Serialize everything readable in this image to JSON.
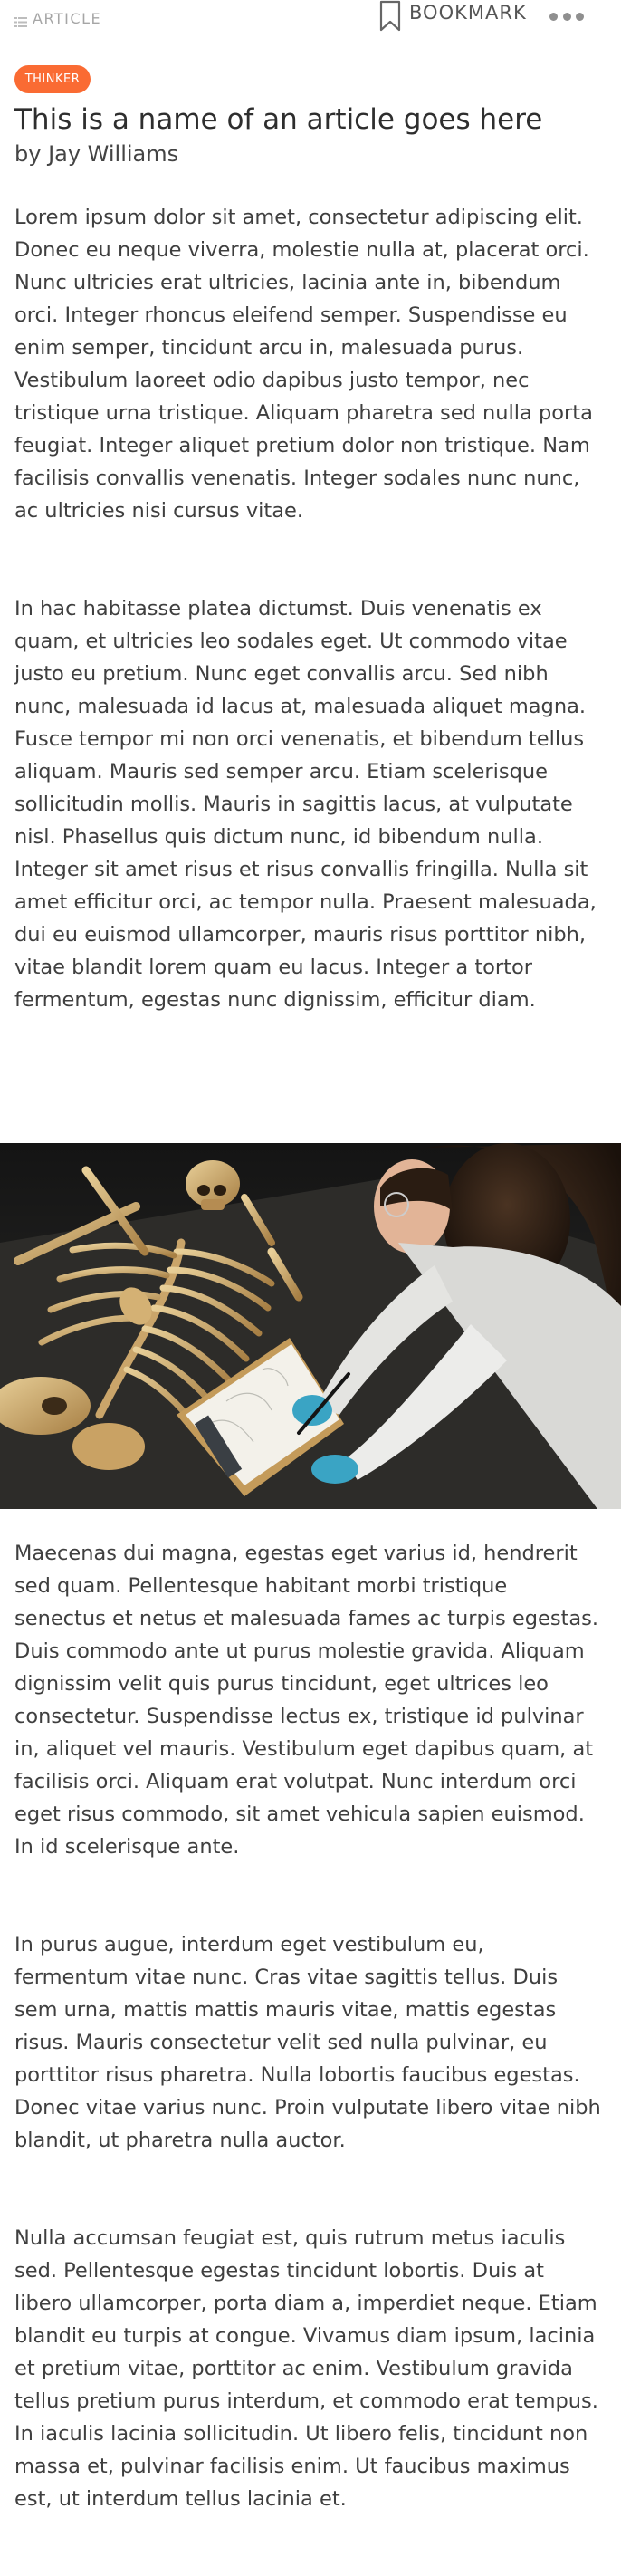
{
  "header": {
    "section_label": "ARTICLE",
    "bookmark_label": "BOOKMARK",
    "icons": {
      "section": "list-icon",
      "bookmark": "bookmark-icon",
      "more": "more-dots-icon"
    }
  },
  "article": {
    "tag": "THINKER",
    "title": "This is a name of an article goes here",
    "byline": "by Jay Williams",
    "paragraphs": [
      "Lorem ipsum dolor sit amet, consectetur adipiscing elit. Donec eu neque viverra, molestie nulla at, placerat orci. Nunc ultricies erat ultricies, lacinia ante in, bibendum orci. Integer rhoncus eleifend semper. Suspendisse eu enim semper, tincidunt arcu in, malesuada purus. Vestibulum laoreet odio dapibus justo tempor, nec tristique urna tristique. Aliquam pharetra sed nulla porta feugiat. Integer aliquet pretium dolor non tristique. Nam facilisis convallis venenatis. Integer sodales nunc nunc, ac ultricies nisi cursus vitae.",
      "In hac habitasse platea dictumst. Duis venenatis ex quam, et ultricies leo sodales eget. Ut commodo vitae justo eu pretium. Nunc eget convallis arcu. Sed nibh nunc, malesuada id lacus at, malesuada aliquet magna. Fusce tempor mi non orci venenatis, et bibendum tellus aliquam. Mauris sed semper arcu. Etiam scelerisque sollicitudin mollis. Mauris in sagittis lacus, at vulputate nisl. Phasellus quis dictum nunc, id bibendum nulla. Integer sit amet risus et risus convallis fringilla. Nulla sit amet efficitur orci, ac tempor nulla. Praesent malesuada, dui eu euismod ullamcorper, mauris risus porttitor nibh, vitae blandit lorem quam eu lacus. Integer a tortor fermentum, egestas nunc dignissim, efficitur diam.",
      "Maecenas dui magna, egestas eget varius id, hendrerit sed quam. Pellentesque habitant morbi tristique senectus et netus et malesuada fames ac turpis egestas. Duis commodo ante ut purus molestie gravida. Aliquam dignissim velit quis purus tincidunt, eget ultrices leo consectetur. Suspendisse lectus ex, tristique id pulvinar in, aliquet vel mauris. Vestibulum eget dapibus quam, at facilisis orci. Aliquam erat volutpat. Nunc interdum orci eget risus commodo, sit amet vehicula sapien euismod. In id scelerisque ante.",
      "In purus augue, interdum eget vestibulum eu, fermentum vitae nunc. Cras vitae sagittis tellus. Duis sem urna, mattis mattis mauris vitae, mattis egestas risus. Mauris consectetur velit sed nulla pulvinar, eu porttitor risus pharetra. Nulla lobortis faucibus egestas. Donec vitae varius nunc. Proin vulputate libero vitae nibh blandit, ut pharetra nulla auctor.",
      "Nulla accumsan feugiat est, quis rutrum metus iaculis sed. Pellentesque egestas tincidunt lobortis. Duis at libero ullamcorper, porta diam a, imperdiet neque. Etiam blandit eu turpis at congue. Vivamus diam ipsum, lacinia et pretium vitae, porttitor ac enim. Vestibulum gravida tellus pretium purus interdum, et commodo erat tempus. In iaculis lacinia sollicitudin. Ut libero felis, tincidunt non massa et, pulvinar facilisis enim. Ut faucibus maximus est, ut interdum tellus lacinia et."
    ]
  },
  "colors": {
    "tag_background": "#fa6b33",
    "text": "#3f3f3f",
    "muted": "#a6a6a6"
  }
}
